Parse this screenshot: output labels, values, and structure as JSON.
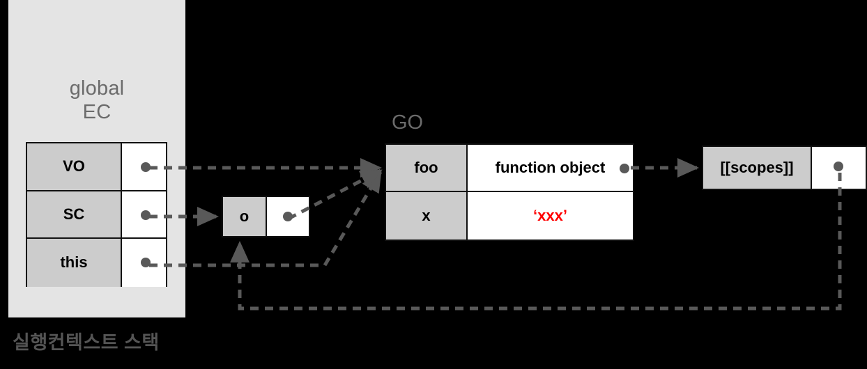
{
  "diagram": {
    "title_stack_caption": "실행컨텍스트 스택",
    "background_color": "#000000",
    "panel_color": "#e4e4e4",
    "key_cell_color": "#cccccc",
    "value_cell_color": "#ffffff",
    "line_color": "#595959",
    "label_color": "#6b6b6b",
    "highlight_color": "#ff0000"
  },
  "ec_panel": {
    "label": "global\nEC",
    "rows": [
      {
        "key": "VO",
        "value": ""
      },
      {
        "key": "SC",
        "value": ""
      },
      {
        "key": "this",
        "value": ""
      }
    ]
  },
  "o_object": {
    "rows": [
      {
        "key": "o",
        "value": ""
      }
    ]
  },
  "go_table": {
    "label": "GO",
    "rows": [
      {
        "key": "foo",
        "value": "function object",
        "value_style": "normal"
      },
      {
        "key": "x",
        "value": "‘xxx’",
        "value_style": "highlight"
      }
    ]
  },
  "scopes_box": {
    "rows": [
      {
        "key": "[[scopes]]",
        "value": ""
      }
    ]
  },
  "connections": [
    {
      "from": "VO",
      "to": "GO.foo"
    },
    {
      "from": "SC",
      "to": "o"
    },
    {
      "from": "this",
      "to": "GO.foo"
    },
    {
      "from": "o.value",
      "to": "GO.foo"
    },
    {
      "from": "GO.foo.value",
      "to": "[[scopes]]"
    },
    {
      "from": "[[scopes]].value",
      "to": "o"
    }
  ]
}
